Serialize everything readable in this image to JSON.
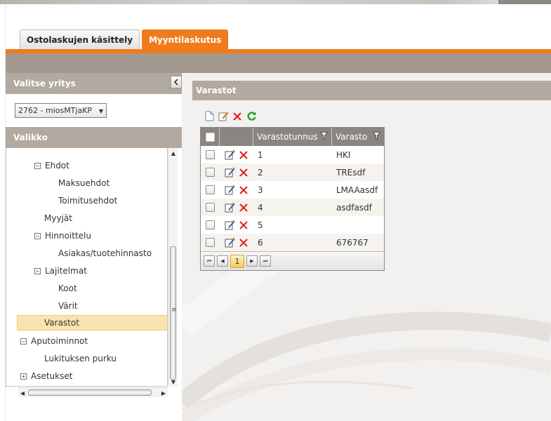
{
  "tabs": [
    {
      "label": "Ostolaskujen käsittely",
      "active": false
    },
    {
      "label": "Myyntilaskutus",
      "active": true
    }
  ],
  "colors": {
    "accent": "#f07b1b",
    "header": "#b2a9a0",
    "band": "#a39890",
    "selected": "#fbe3b1"
  },
  "company": {
    "header": "Valitse yritys",
    "selected": "2762 - miosMTjaKP"
  },
  "menu": {
    "header": "Valikko",
    "items": [
      {
        "label": "Ehdot",
        "toggle": "⊟"
      },
      {
        "label": "Maksuehdot"
      },
      {
        "label": "Toimitusehdot"
      },
      {
        "label": "Myyjät"
      },
      {
        "label": "Hinnoittelu",
        "toggle": "⊟"
      },
      {
        "label": "Asiakas/tuotehinnasto"
      },
      {
        "label": "Lajitelmat",
        "toggle": "⊟"
      },
      {
        "label": "Koot"
      },
      {
        "label": "Värit"
      },
      {
        "label": "Varastot",
        "selected": true
      },
      {
        "label": "Aputoiminnot",
        "toggle": "⊟"
      },
      {
        "label": "Lukituksen purku"
      },
      {
        "label": "Asetukset",
        "toggle": "⊞"
      }
    ]
  },
  "content": {
    "title": "Varastot",
    "toolbar": [
      "new-icon",
      "edit-icon",
      "delete-icon",
      "refresh-icon"
    ],
    "grid": {
      "columns": [
        "Varastotunnus",
        "Varasto"
      ],
      "rows": [
        {
          "id": "1",
          "name": "HKI"
        },
        {
          "id": "2",
          "name": "TREsdf"
        },
        {
          "id": "3",
          "name": "LMAAasdf"
        },
        {
          "id": "4",
          "name": "asdfasdf"
        },
        {
          "id": "5",
          "name": ""
        },
        {
          "id": "6",
          "name": "676767"
        }
      ],
      "current_page": "1"
    }
  }
}
